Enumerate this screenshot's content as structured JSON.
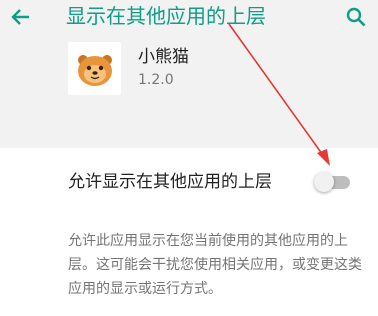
{
  "toolbar": {
    "title": "显示在其他应用的上层",
    "back_icon": "arrow-left-icon",
    "search_icon": "search-icon",
    "icon_color": "#0f9e86"
  },
  "app": {
    "name": "小熊猫",
    "version": "1.2.0",
    "icon": "panda-face-icon"
  },
  "setting": {
    "label": "允许显示在其他应用的上层",
    "toggle_on": false
  },
  "description": "允许此应用显示在您当前使用的其他应用的上层。这可能会干扰您使用相关应用，或变更这类应用的显示或运行方式。",
  "colors": {
    "accent": "#0f9e86",
    "header_background": "#f2f2f2",
    "annotation_arrow": "#e53935"
  }
}
